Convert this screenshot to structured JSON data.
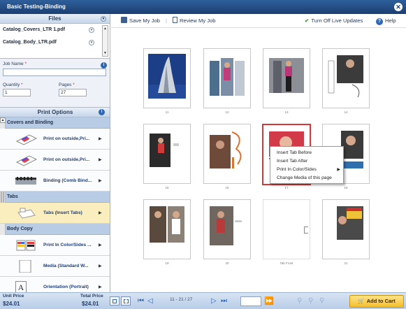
{
  "window": {
    "title": "Basic Testing-Binding"
  },
  "files_panel": {
    "header": "Files",
    "files": [
      {
        "name": "Catalog_Covers_LTR 1.pdf"
      },
      {
        "name": "Catalog_Body_LTR.pdf"
      }
    ]
  },
  "job": {
    "job_name_label": "Job Name",
    "job_name_value": "",
    "quantity_label": "Quantity",
    "quantity_value": "1",
    "pages_label": "Pages",
    "pages_value": "27",
    "required_mark": "*"
  },
  "print_options": {
    "header": "Print Options",
    "sections": [
      {
        "title": "Covers and Binding",
        "items": [
          {
            "label": "Print on outside,Pri...",
            "icon": "print-outside-icon"
          },
          {
            "label": "Print on outside,Pri...",
            "icon": "print-outside-icon"
          },
          {
            "label": "Binding (Comb Bind...",
            "icon": "comb-binding-icon"
          }
        ]
      },
      {
        "title": "Tabs",
        "items": [
          {
            "label": "Tabs (Insert Tabs)",
            "icon": "tabs-icon",
            "selected": true
          }
        ]
      },
      {
        "title": "Body Copy",
        "items": [
          {
            "label": "Print In Color/Sides ...",
            "icon": "color-sides-icon"
          },
          {
            "label": "Media (Standard W...",
            "icon": "media-icon"
          },
          {
            "label": "Orientation (Portrait)",
            "icon": "orientation-icon",
            "icon_letter": "A"
          }
        ]
      }
    ]
  },
  "toolbar": {
    "save": "Save My Job",
    "review": "Review My Job",
    "live_updates": "Turn Off Live Updates",
    "help": "Help"
  },
  "pages": [
    {
      "number": "11"
    },
    {
      "number": "12"
    },
    {
      "number": "13"
    },
    {
      "number": "14"
    },
    {
      "number": "15"
    },
    {
      "number": "16"
    },
    {
      "number": "17"
    },
    {
      "number": "18"
    },
    {
      "number": "19"
    },
    {
      "number": "20"
    },
    {
      "number": "Tab Front"
    },
    {
      "number": "21"
    }
  ],
  "context_menu": {
    "items": [
      {
        "label": "Insert Tab Before"
      },
      {
        "label": "Insert Tab After"
      },
      {
        "label": "Print In Color/Sides",
        "submenu": true
      },
      {
        "label": "Change Media of this page"
      }
    ]
  },
  "footer": {
    "unit_price_label": "Unit Price",
    "unit_price": "$24.01",
    "total_price_label": "Total Price",
    "total_price": "$24.01",
    "page_range": "11 - 21 / 27",
    "goto_value": "",
    "add_to_cart": "Add to Cart"
  },
  "colors": {
    "title_bar": "#1b3f72",
    "accent": "#2e67b2",
    "active_border": "#d73636",
    "cart": "#f4bf2c"
  }
}
